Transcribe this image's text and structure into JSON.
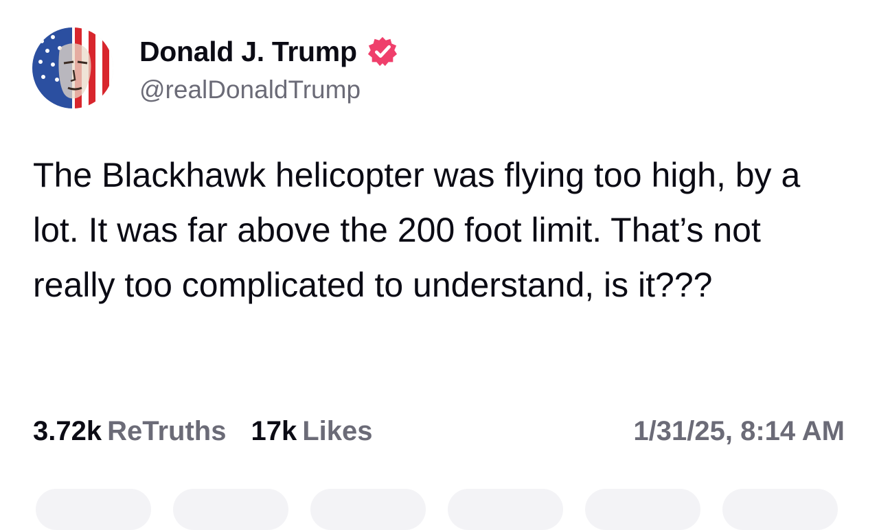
{
  "author": {
    "display_name": "Donald J. Trump",
    "handle": "@realDonaldTrump",
    "verified_icon": "verified-badge-icon",
    "avatar_icon": "avatar-image"
  },
  "post": {
    "text": "The Blackhawk helicopter was flying too high, by a lot. It was far above the 200 foot limit. That’s not really too complicated to understand, is it???"
  },
  "stats": {
    "retruths_count": "3.72k",
    "retruths_label": "ReTruths",
    "likes_count": "17k",
    "likes_label": "Likes",
    "timestamp": "1/31/25, 8:14 AM"
  },
  "colors": {
    "verified_badge": "#ef3f6b",
    "muted_text": "#6b6b77",
    "primary_text": "#0b0b14",
    "action_pill_bg": "#f3f3f6"
  }
}
